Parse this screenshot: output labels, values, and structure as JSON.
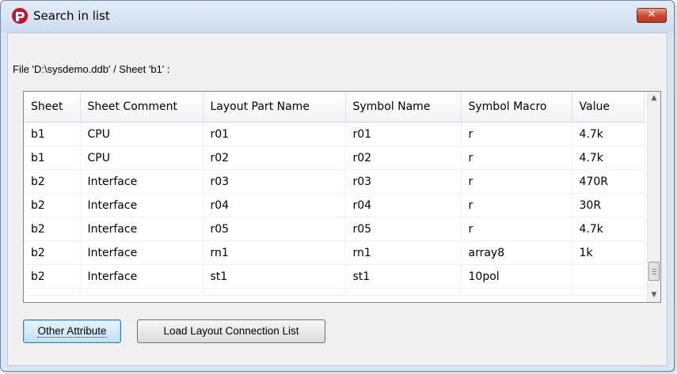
{
  "window": {
    "title": "Search in list",
    "close_icon": "close-icon",
    "app_icon": "app-logo-icon"
  },
  "file_label": "File 'D:\\sysdemo.ddb' / Sheet 'b1' :",
  "table": {
    "columns": [
      "Sheet",
      "Sheet Comment",
      "Layout Part Name",
      "Symbol Name",
      "Symbol Macro",
      "Value"
    ],
    "rows": [
      [
        "b1",
        "CPU",
        "r01",
        "r01",
        "r",
        "4.7k"
      ],
      [
        "b1",
        "CPU",
        "r02",
        "r02",
        "r",
        "4.7k"
      ],
      [
        "b2",
        "Interface",
        "r03",
        "r03",
        "r",
        "470R"
      ],
      [
        "b2",
        "Interface",
        "r04",
        "r04",
        "r",
        "30R"
      ],
      [
        "b2",
        "Interface",
        "r05",
        "r05",
        "r",
        "4.7k"
      ],
      [
        "b2",
        "Interface",
        "rn1",
        "rn1",
        "array8",
        "1k"
      ],
      [
        "b2",
        "Interface",
        "st1",
        "st1",
        "10pol",
        ""
      ]
    ]
  },
  "buttons": {
    "other_attribute": "Other Attribute",
    "load_layout": "Load Layout Connection List"
  },
  "colors": {
    "window_bg": "#dbe6f3",
    "close_button": "#c9462d",
    "focused_button": "#bfe0f6"
  }
}
